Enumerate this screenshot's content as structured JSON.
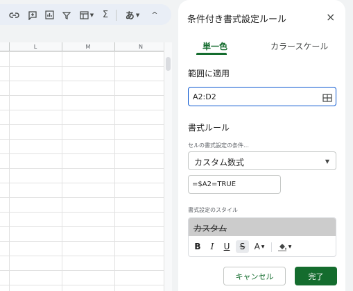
{
  "toolbar": {
    "items": [
      {
        "icon": "link-icon"
      },
      {
        "icon": "add-comment-icon"
      },
      {
        "icon": "insert-chart-icon"
      },
      {
        "icon": "filter-icon"
      },
      {
        "icon": "filter-views-icon"
      },
      {
        "icon": "functions-icon",
        "glyph": "Σ"
      },
      {
        "icon": "input-tools-icon",
        "glyph": "あ"
      },
      {
        "icon": "collapse-chevron-icon",
        "glyph": "^"
      }
    ]
  },
  "sheet": {
    "columns": [
      "L",
      "M",
      "N"
    ]
  },
  "panel": {
    "title": "条件付き書式設定ルール",
    "close_glyph": "×",
    "tabs": [
      {
        "label": "単一色",
        "selected": true
      },
      {
        "label": "カラースケール",
        "selected": false
      }
    ],
    "range_label": "範囲に適用",
    "range_value": "A2:D2",
    "rules_label": "書式ルール",
    "condition_label": "セルの書式設定の条件…",
    "condition_value": "カスタム数式",
    "formula_value": "=$A2=TRUE",
    "style_label": "書式設定のスタイル",
    "preview_text": "カスタム",
    "format_buttons": {
      "bold": "B",
      "italic": "I",
      "underline": "U",
      "strikethrough": "S",
      "text_color": "A"
    },
    "cancel_label": "キャンセル",
    "done_label": "完了"
  },
  "colors": {
    "accent_green": "#146c2e",
    "focus_blue": "#0b57d0",
    "preview_fill": "#cccccc"
  }
}
